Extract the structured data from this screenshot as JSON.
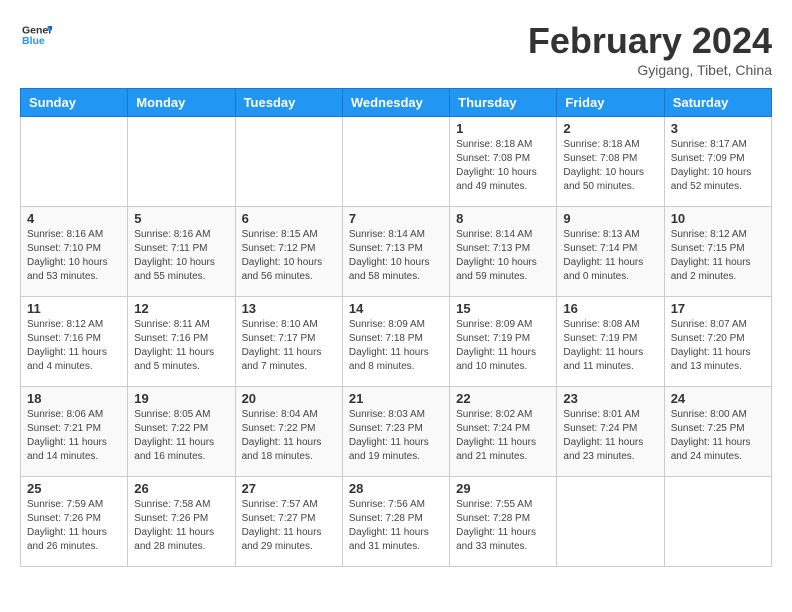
{
  "header": {
    "logo_line1": "General",
    "logo_line2": "Blue",
    "month_year": "February 2024",
    "location": "Gyigang, Tibet, China"
  },
  "weekdays": [
    "Sunday",
    "Monday",
    "Tuesday",
    "Wednesday",
    "Thursday",
    "Friday",
    "Saturday"
  ],
  "weeks": [
    [
      {
        "day": "",
        "info": ""
      },
      {
        "day": "",
        "info": ""
      },
      {
        "day": "",
        "info": ""
      },
      {
        "day": "",
        "info": ""
      },
      {
        "day": "1",
        "info": "Sunrise: 8:18 AM\nSunset: 7:08 PM\nDaylight: 10 hours\nand 49 minutes."
      },
      {
        "day": "2",
        "info": "Sunrise: 8:18 AM\nSunset: 7:08 PM\nDaylight: 10 hours\nand 50 minutes."
      },
      {
        "day": "3",
        "info": "Sunrise: 8:17 AM\nSunset: 7:09 PM\nDaylight: 10 hours\nand 52 minutes."
      }
    ],
    [
      {
        "day": "4",
        "info": "Sunrise: 8:16 AM\nSunset: 7:10 PM\nDaylight: 10 hours\nand 53 minutes."
      },
      {
        "day": "5",
        "info": "Sunrise: 8:16 AM\nSunset: 7:11 PM\nDaylight: 10 hours\nand 55 minutes."
      },
      {
        "day": "6",
        "info": "Sunrise: 8:15 AM\nSunset: 7:12 PM\nDaylight: 10 hours\nand 56 minutes."
      },
      {
        "day": "7",
        "info": "Sunrise: 8:14 AM\nSunset: 7:13 PM\nDaylight: 10 hours\nand 58 minutes."
      },
      {
        "day": "8",
        "info": "Sunrise: 8:14 AM\nSunset: 7:13 PM\nDaylight: 10 hours\nand 59 minutes."
      },
      {
        "day": "9",
        "info": "Sunrise: 8:13 AM\nSunset: 7:14 PM\nDaylight: 11 hours\nand 0 minutes."
      },
      {
        "day": "10",
        "info": "Sunrise: 8:12 AM\nSunset: 7:15 PM\nDaylight: 11 hours\nand 2 minutes."
      }
    ],
    [
      {
        "day": "11",
        "info": "Sunrise: 8:12 AM\nSunset: 7:16 PM\nDaylight: 11 hours\nand 4 minutes."
      },
      {
        "day": "12",
        "info": "Sunrise: 8:11 AM\nSunset: 7:16 PM\nDaylight: 11 hours\nand 5 minutes."
      },
      {
        "day": "13",
        "info": "Sunrise: 8:10 AM\nSunset: 7:17 PM\nDaylight: 11 hours\nand 7 minutes."
      },
      {
        "day": "14",
        "info": "Sunrise: 8:09 AM\nSunset: 7:18 PM\nDaylight: 11 hours\nand 8 minutes."
      },
      {
        "day": "15",
        "info": "Sunrise: 8:09 AM\nSunset: 7:19 PM\nDaylight: 11 hours\nand 10 minutes."
      },
      {
        "day": "16",
        "info": "Sunrise: 8:08 AM\nSunset: 7:19 PM\nDaylight: 11 hours\nand 11 minutes."
      },
      {
        "day": "17",
        "info": "Sunrise: 8:07 AM\nSunset: 7:20 PM\nDaylight: 11 hours\nand 13 minutes."
      }
    ],
    [
      {
        "day": "18",
        "info": "Sunrise: 8:06 AM\nSunset: 7:21 PM\nDaylight: 11 hours\nand 14 minutes."
      },
      {
        "day": "19",
        "info": "Sunrise: 8:05 AM\nSunset: 7:22 PM\nDaylight: 11 hours\nand 16 minutes."
      },
      {
        "day": "20",
        "info": "Sunrise: 8:04 AM\nSunset: 7:22 PM\nDaylight: 11 hours\nand 18 minutes."
      },
      {
        "day": "21",
        "info": "Sunrise: 8:03 AM\nSunset: 7:23 PM\nDaylight: 11 hours\nand 19 minutes."
      },
      {
        "day": "22",
        "info": "Sunrise: 8:02 AM\nSunset: 7:24 PM\nDaylight: 11 hours\nand 21 minutes."
      },
      {
        "day": "23",
        "info": "Sunrise: 8:01 AM\nSunset: 7:24 PM\nDaylight: 11 hours\nand 23 minutes."
      },
      {
        "day": "24",
        "info": "Sunrise: 8:00 AM\nSunset: 7:25 PM\nDaylight: 11 hours\nand 24 minutes."
      }
    ],
    [
      {
        "day": "25",
        "info": "Sunrise: 7:59 AM\nSunset: 7:26 PM\nDaylight: 11 hours\nand 26 minutes."
      },
      {
        "day": "26",
        "info": "Sunrise: 7:58 AM\nSunset: 7:26 PM\nDaylight: 11 hours\nand 28 minutes."
      },
      {
        "day": "27",
        "info": "Sunrise: 7:57 AM\nSunset: 7:27 PM\nDaylight: 11 hours\nand 29 minutes."
      },
      {
        "day": "28",
        "info": "Sunrise: 7:56 AM\nSunset: 7:28 PM\nDaylight: 11 hours\nand 31 minutes."
      },
      {
        "day": "29",
        "info": "Sunrise: 7:55 AM\nSunset: 7:28 PM\nDaylight: 11 hours\nand 33 minutes."
      },
      {
        "day": "",
        "info": ""
      },
      {
        "day": "",
        "info": ""
      }
    ]
  ]
}
